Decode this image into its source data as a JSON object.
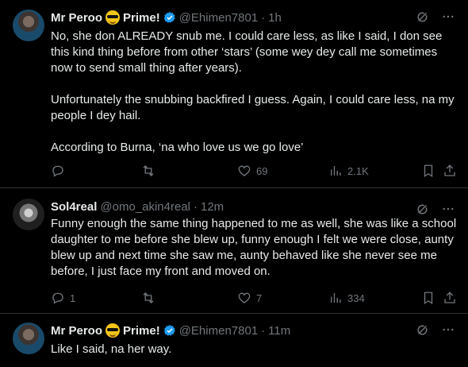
{
  "tweets": [
    {
      "name": "Mr Peroo",
      "name_suffix": "Prime!",
      "handle": "@Ehimen7801",
      "time": "1h",
      "text": "No, she don ALREADY snub me. I could care less, as like I said, I don see this kind thing before from other ‘stars’ (some wey dey call me sometimes now to send small thing after years).\n\nUnfortunately the snubbing backfired I guess. Again, I could care less, na my people I dey hail.\n\nAccording to Burna, ‘na who love us we go love’",
      "replies": "",
      "retweets": "",
      "likes": "69",
      "views": "2.1K"
    },
    {
      "name": "Sol4real",
      "handle": "@omo_akin4real",
      "time": "12m",
      "text": "Funny enough the same thing happened to me as well, she was like a school daughter to me before she blew up, funny enough I felt we were close, aunty blew up and next time she saw me, aunty behaved like she never see me before, I just face my front and moved on.",
      "replies": "1",
      "retweets": "",
      "likes": "7",
      "views": "334"
    },
    {
      "name": "Mr Peroo",
      "name_suffix": "Prime!",
      "handle": "@Ehimen7801",
      "time": "11m",
      "text": "Like I said, na her way."
    }
  ],
  "colors": {
    "background": "#000000",
    "text": "#e7e9ea",
    "secondary": "#71767b",
    "verified": "#1d9bf0",
    "divider": "#2f3336"
  },
  "icons": [
    "grok-icon",
    "more-icon",
    "reply-icon",
    "retweet-icon",
    "like-icon",
    "views-icon",
    "bookmark-icon",
    "share-icon",
    "verified-icon",
    "sunglasses-emoji"
  ]
}
